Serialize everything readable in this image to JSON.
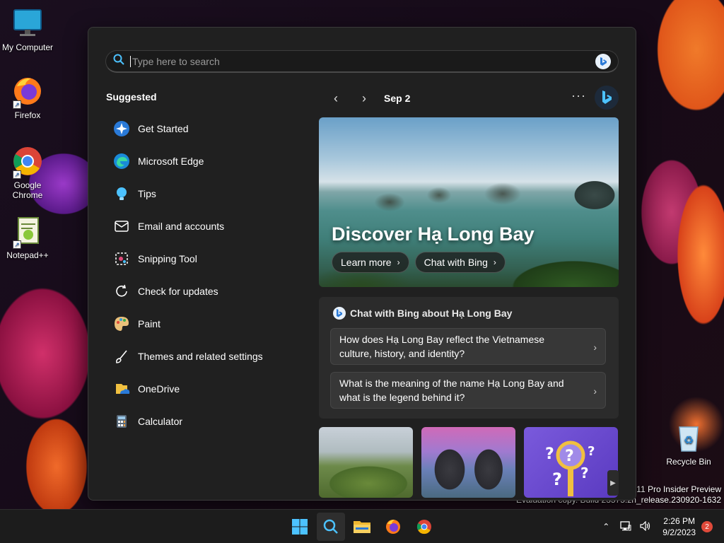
{
  "desktop": {
    "icons": [
      {
        "label": "My Computer"
      },
      {
        "label": "Firefox"
      },
      {
        "label": "Google Chrome"
      },
      {
        "label": "Notepad++"
      },
      {
        "label": "Recycle Bin"
      }
    ],
    "watermark": {
      "line1": "s 11 Pro Insider Preview",
      "line2": "Evaluation copy. Build 23575.zn_release.230920-1632"
    }
  },
  "search": {
    "placeholder": "Type here to search",
    "value": ""
  },
  "suggested": {
    "title": "Suggested",
    "items": [
      {
        "label": "Get Started",
        "icon": "get-started-icon"
      },
      {
        "label": "Microsoft Edge",
        "icon": "edge-icon"
      },
      {
        "label": "Tips",
        "icon": "tips-icon"
      },
      {
        "label": "Email and accounts",
        "icon": "mail-icon"
      },
      {
        "label": "Snipping Tool",
        "icon": "snipping-tool-icon"
      },
      {
        "label": "Check for updates",
        "icon": "refresh-icon"
      },
      {
        "label": "Paint",
        "icon": "paint-icon"
      },
      {
        "label": "Themes and related settings",
        "icon": "brush-icon"
      },
      {
        "label": "OneDrive",
        "icon": "onedrive-icon"
      },
      {
        "label": "Calculator",
        "icon": "calculator-icon"
      }
    ]
  },
  "highlights": {
    "date": "Sep 2",
    "hero": {
      "title": "Discover Hạ Long Bay",
      "learn_more": "Learn more",
      "chat_with_bing": "Chat with Bing"
    },
    "chat": {
      "title": "Chat with Bing about Hạ Long Bay",
      "questions": [
        "How does Hạ Long Bay reflect the Vietnamese culture, history, and identity?",
        "What is the meaning of the name Hạ Long Bay and what is the legend behind it?"
      ]
    }
  },
  "taskbar": {
    "time": "2:26 PM",
    "date": "9/2/2023",
    "notifications": "2"
  },
  "colors": {
    "panel_bg": "#202020",
    "accent": "#4cc2ff",
    "bing_blue": "#2a7ad8"
  }
}
